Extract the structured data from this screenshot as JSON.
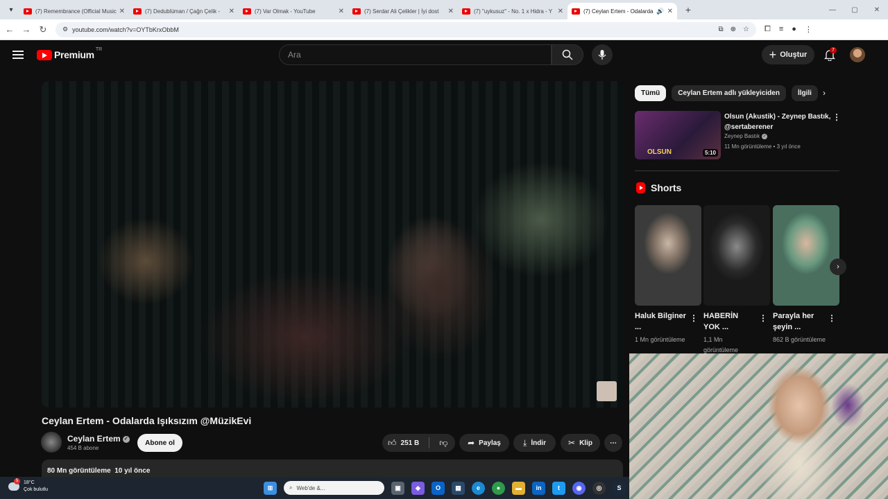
{
  "browser": {
    "tabs": [
      {
        "title": "(7) Remembrance (Official Music",
        "active": false
      },
      {
        "title": "(7) Dedublüman / Çağn Çelik -",
        "active": false
      },
      {
        "title": "(7) Var Olmak - YouTube",
        "active": false
      },
      {
        "title": "(7) Serdar Ali Çelikler | İyi dost",
        "active": false
      },
      {
        "title": "(7) \"uykusuz\" - No. 1 x Hidra - Y",
        "active": false
      },
      {
        "title": "(7) Ceylan Ertem - Odalarda",
        "active": true
      }
    ],
    "url": "youtube.com/watch?v=OYTbKrxObbM"
  },
  "header": {
    "logo_text": "Premium",
    "region": "TR",
    "search_placeholder": "Ara",
    "create_label": "Oluştur",
    "notifications_count": "7"
  },
  "video": {
    "title": "Ceylan Ertem - Odalarda Işıksızım @MüzikEvi",
    "channel": "Ceylan Ertem",
    "subscribers": "454 B abone",
    "subscribe_label": "Abone ol",
    "likes": "251 B",
    "share_label": "Paylaş",
    "download_label": "İndir",
    "clip_label": "Klip",
    "views": "80 Mn görüntüleme",
    "age": "10 yıl önce"
  },
  "sidebar": {
    "chips": [
      "Tümü",
      "Ceylan Ertem adlı yükleyiciden",
      "İlgili"
    ],
    "recommendation": {
      "title": "Olsun (Akustik) - Zeynep Bastık, @sertaberener",
      "channel": "Zeynep Bastık",
      "meta": "11 Mn görüntüleme • 3 yıl önce",
      "duration": "5:10",
      "thumb_text": "OLSUN"
    },
    "shorts_label": "Shorts",
    "shorts": [
      {
        "title": "Haluk Bilginer ...",
        "views": "1 Mn görüntüleme"
      },
      {
        "title": "HABERİN YOK ...",
        "views": "1,1 Mn görüntüleme"
      },
      {
        "title": "Parayla her şeyin ...",
        "views": "862 B görüntüleme"
      }
    ]
  },
  "taskbar": {
    "weather_temp": "18°C",
    "weather_desc": "Çok bulutlu",
    "weather_badge": "5",
    "search_placeholder": "Web'de &..."
  }
}
